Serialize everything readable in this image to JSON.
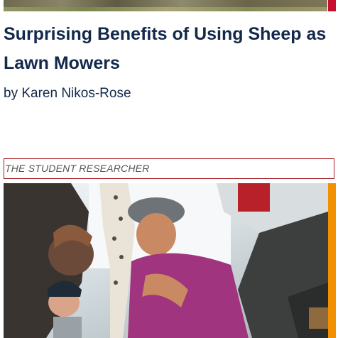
{
  "article": {
    "headline": "Surprising Benefits of Using Sheep as Lawn Mowers",
    "byline": "by Karen Nikos-Rose"
  },
  "next_section": {
    "label": "THE STUDENT RESEARCHER"
  },
  "colors": {
    "headline": "#13294b",
    "top_accent": "#c8102e",
    "label_border": "#a3191e",
    "photo_accent": "#f29100"
  }
}
